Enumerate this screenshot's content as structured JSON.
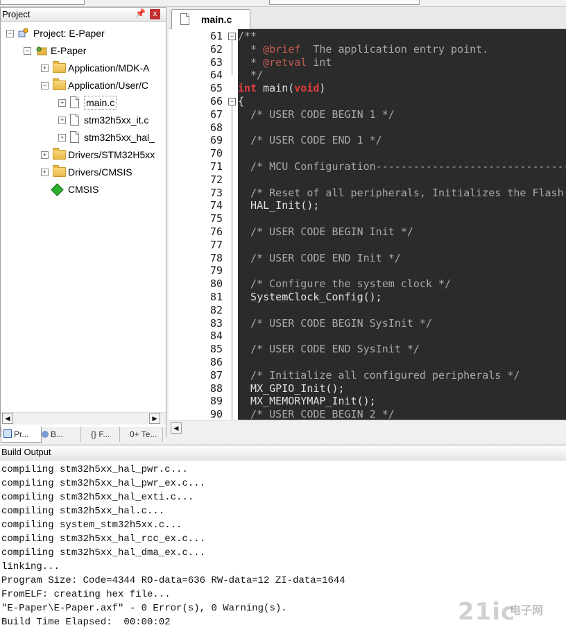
{
  "colors": {
    "editor_bg": "#2b2b2b",
    "comment": "#a9a9a9",
    "doc_tag": "#c25b4f",
    "keyword": "#e03c3c",
    "close_btn": "#c43131"
  },
  "project_panel": {
    "title": "Project",
    "pin_glyph": "ᵖ",
    "close_glyph": "x",
    "tree": [
      {
        "label": "Project: E-Paper",
        "icon": "project-icon",
        "expand": "−"
      },
      {
        "label": "E-Paper",
        "icon": "target-icon",
        "expand": "−"
      },
      {
        "label": "Application/MDK-A",
        "icon": "folder-icon",
        "expand": "+"
      },
      {
        "label": "Application/User/C",
        "icon": "folder-open-icon",
        "expand": "−"
      },
      {
        "label": "main.c",
        "icon": "file-icon",
        "expand": "+"
      },
      {
        "label": "stm32h5xx_it.c",
        "icon": "file-icon",
        "expand": "+"
      },
      {
        "label": "stm32h5xx_hal_",
        "icon": "file-icon",
        "expand": "+"
      },
      {
        "label": "Drivers/STM32H5xx",
        "icon": "folder-icon",
        "expand": "+"
      },
      {
        "label": "Drivers/CMSIS",
        "icon": "folder-icon",
        "expand": "+"
      },
      {
        "label": "CMSIS",
        "icon": "cmsis-diamond-icon",
        "expand": ""
      }
    ],
    "tabs": [
      "Pr...",
      "B...",
      "{} F...",
      "0+ Te..."
    ]
  },
  "editor": {
    "tab_label": "main.c",
    "lines": [
      {
        "n": "61",
        "fold": "−"
      },
      {
        "n": "62",
        "fold": ""
      },
      {
        "n": "63",
        "fold": ""
      },
      {
        "n": "64",
        "fold": "end"
      },
      {
        "n": "65",
        "fold": ""
      },
      {
        "n": "66",
        "fold": "−"
      },
      {
        "n": "67",
        "fold": ""
      },
      {
        "n": "68",
        "fold": ""
      },
      {
        "n": "69",
        "fold": ""
      },
      {
        "n": "70",
        "fold": ""
      },
      {
        "n": "71",
        "fold": ""
      },
      {
        "n": "72",
        "fold": ""
      },
      {
        "n": "73",
        "fold": ""
      },
      {
        "n": "74",
        "fold": ""
      },
      {
        "n": "75",
        "fold": ""
      },
      {
        "n": "76",
        "fold": ""
      },
      {
        "n": "77",
        "fold": ""
      },
      {
        "n": "78",
        "fold": ""
      },
      {
        "n": "79",
        "fold": ""
      },
      {
        "n": "80",
        "fold": ""
      },
      {
        "n": "81",
        "fold": ""
      },
      {
        "n": "82",
        "fold": ""
      },
      {
        "n": "83",
        "fold": ""
      },
      {
        "n": "84",
        "fold": ""
      },
      {
        "n": "85",
        "fold": ""
      },
      {
        "n": "86",
        "fold": ""
      },
      {
        "n": "87",
        "fold": ""
      },
      {
        "n": "88",
        "fold": ""
      },
      {
        "n": "89",
        "fold": ""
      },
      {
        "n": "90",
        "fold": ""
      }
    ],
    "code": [
      [
        [
          "cmt",
          "/**"
        ]
      ],
      [
        [
          "cmt",
          "  * "
        ],
        [
          "tag",
          "@brief"
        ],
        [
          "cmt",
          "  The application entry point."
        ]
      ],
      [
        [
          "cmt",
          "  * "
        ],
        [
          "tag",
          "@retval"
        ],
        [
          "cmt",
          " int"
        ]
      ],
      [
        [
          "cmt",
          "  */"
        ]
      ],
      [
        [
          "kw",
          "int"
        ],
        [
          "txt",
          " main("
        ],
        [
          "kw",
          "void"
        ],
        [
          "txt",
          ")"
        ]
      ],
      [
        [
          "txt",
          "{"
        ]
      ],
      [
        [
          "cmt",
          "  /* USER CODE BEGIN 1 */"
        ]
      ],
      [],
      [
        [
          "cmt",
          "  /* USER CODE END 1 */"
        ]
      ],
      [],
      [
        [
          "cmt",
          "  /* MCU Configuration--------------------------------------------------------*/"
        ]
      ],
      [],
      [
        [
          "cmt",
          "  /* Reset of all peripherals, Initializes the Flash interface and the Systick. */"
        ]
      ],
      [
        [
          "txt",
          "  HAL_Init();"
        ]
      ],
      [],
      [
        [
          "cmt",
          "  /* USER CODE BEGIN Init */"
        ]
      ],
      [],
      [
        [
          "cmt",
          "  /* USER CODE END Init */"
        ]
      ],
      [],
      [
        [
          "cmt",
          "  /* Configure the system clock */"
        ]
      ],
      [
        [
          "txt",
          "  SystemClock_Config();"
        ]
      ],
      [],
      [
        [
          "cmt",
          "  /* USER CODE BEGIN SysInit */"
        ]
      ],
      [],
      [
        [
          "cmt",
          "  /* USER CODE END SysInit */"
        ]
      ],
      [],
      [
        [
          "cmt",
          "  /* Initialize all configured peripherals */"
        ]
      ],
      [
        [
          "txt",
          "  MX_GPIO_Init();"
        ]
      ],
      [
        [
          "txt",
          "  MX_MEMORYMAP_Init();"
        ]
      ],
      [
        [
          "cmt",
          "  /* USER CODE BEGIN 2 */"
        ]
      ]
    ]
  },
  "build_output": {
    "title": "Build Output",
    "lines": [
      "compiling stm32h5xx_hal_pwr.c...",
      "compiling stm32h5xx_hal_pwr_ex.c...",
      "compiling stm32h5xx_hal_exti.c...",
      "compiling stm32h5xx_hal.c...",
      "compiling system_stm32h5xx.c...",
      "compiling stm32h5xx_hal_rcc_ex.c...",
      "compiling stm32h5xx_hal_dma_ex.c...",
      "linking...",
      "Program Size: Code=4344 RO-data=636 RW-data=12 ZI-data=1644",
      "FromELF: creating hex file...",
      "\"E-Paper\\E-Paper.axf\" - 0 Error(s), 0 Warning(s).",
      "Build Time Elapsed:  00:00:02"
    ]
  },
  "watermark": {
    "logo": "21ic",
    "cn": "电子网"
  }
}
